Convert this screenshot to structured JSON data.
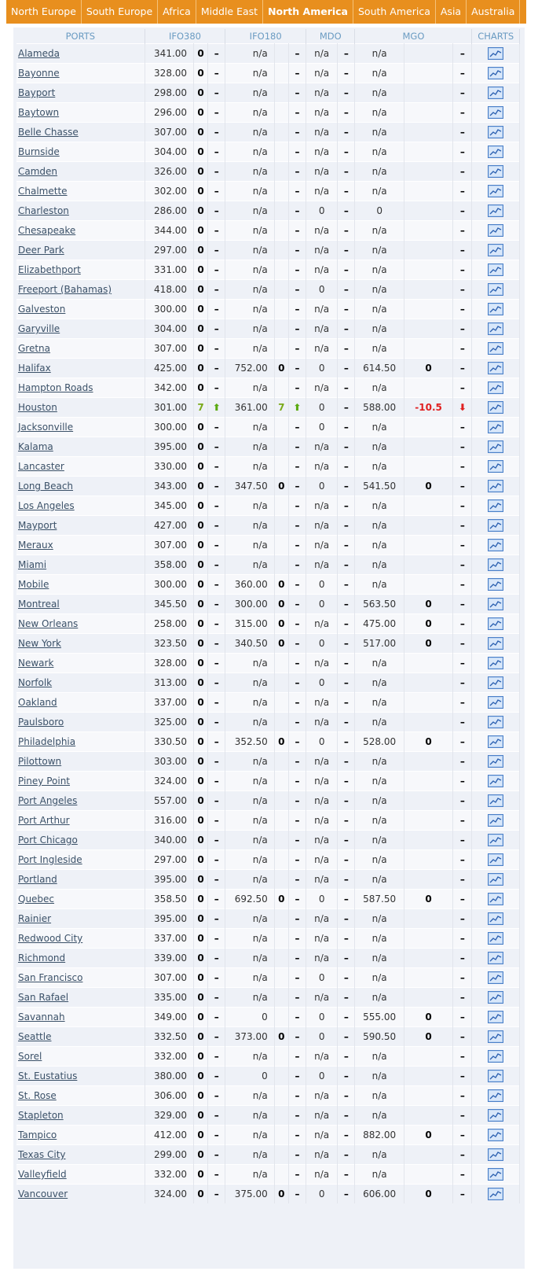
{
  "tabs": [
    {
      "label": "North Europe",
      "active": false
    },
    {
      "label": "South Europe",
      "active": false
    },
    {
      "label": "Africa",
      "active": false
    },
    {
      "label": "Middle East",
      "active": false
    },
    {
      "label": "North America",
      "active": true
    },
    {
      "label": "South America",
      "active": false
    },
    {
      "label": "Asia",
      "active": false
    },
    {
      "label": "Australia",
      "active": false
    }
  ],
  "headers": {
    "ports": "PORTS",
    "ifo380": "IFO380",
    "ifo180": "IFO180",
    "mdo": "MDO",
    "mgo": "MGO",
    "charts": "CHARTS"
  },
  "rows": [
    {
      "port": "Alameda",
      "ifo380": "341.00",
      "ifo380_chg": "0",
      "ifo380_dir": "",
      "ifo180": "n/a",
      "ifo180_chg": "",
      "ifo180_dir": "",
      "mdo": "n/a",
      "mgo": "n/a",
      "mgo_chg": "",
      "mgo_dir": ""
    },
    {
      "port": "Bayonne",
      "ifo380": "328.00",
      "ifo380_chg": "0",
      "ifo380_dir": "",
      "ifo180": "n/a",
      "ifo180_chg": "",
      "ifo180_dir": "",
      "mdo": "n/a",
      "mgo": "n/a",
      "mgo_chg": "",
      "mgo_dir": ""
    },
    {
      "port": "Bayport",
      "ifo380": "298.00",
      "ifo380_chg": "0",
      "ifo380_dir": "",
      "ifo180": "n/a",
      "ifo180_chg": "",
      "ifo180_dir": "",
      "mdo": "n/a",
      "mgo": "n/a",
      "mgo_chg": "",
      "mgo_dir": ""
    },
    {
      "port": "Baytown",
      "ifo380": "296.00",
      "ifo380_chg": "0",
      "ifo380_dir": "",
      "ifo180": "n/a",
      "ifo180_chg": "",
      "ifo180_dir": "",
      "mdo": "n/a",
      "mgo": "n/a",
      "mgo_chg": "",
      "mgo_dir": ""
    },
    {
      "port": "Belle Chasse",
      "ifo380": "307.00",
      "ifo380_chg": "0",
      "ifo380_dir": "",
      "ifo180": "n/a",
      "ifo180_chg": "",
      "ifo180_dir": "",
      "mdo": "n/a",
      "mgo": "n/a",
      "mgo_chg": "",
      "mgo_dir": ""
    },
    {
      "port": "Burnside",
      "ifo380": "304.00",
      "ifo380_chg": "0",
      "ifo380_dir": "",
      "ifo180": "n/a",
      "ifo180_chg": "",
      "ifo180_dir": "",
      "mdo": "n/a",
      "mgo": "n/a",
      "mgo_chg": "",
      "mgo_dir": ""
    },
    {
      "port": "Camden",
      "ifo380": "326.00",
      "ifo380_chg": "0",
      "ifo380_dir": "",
      "ifo180": "n/a",
      "ifo180_chg": "",
      "ifo180_dir": "",
      "mdo": "n/a",
      "mgo": "n/a",
      "mgo_chg": "",
      "mgo_dir": ""
    },
    {
      "port": "Chalmette",
      "ifo380": "302.00",
      "ifo380_chg": "0",
      "ifo380_dir": "",
      "ifo180": "n/a",
      "ifo180_chg": "",
      "ifo180_dir": "",
      "mdo": "n/a",
      "mgo": "n/a",
      "mgo_chg": "",
      "mgo_dir": ""
    },
    {
      "port": "Charleston",
      "ifo380": "286.00",
      "ifo380_chg": "0",
      "ifo380_dir": "",
      "ifo180": "n/a",
      "ifo180_chg": "",
      "ifo180_dir": "",
      "mdo": "0",
      "mgo": "0",
      "mgo_chg": "",
      "mgo_dir": ""
    },
    {
      "port": "Chesapeake",
      "ifo380": "344.00",
      "ifo380_chg": "0",
      "ifo380_dir": "",
      "ifo180": "n/a",
      "ifo180_chg": "",
      "ifo180_dir": "",
      "mdo": "n/a",
      "mgo": "n/a",
      "mgo_chg": "",
      "mgo_dir": ""
    },
    {
      "port": "Deer Park",
      "ifo380": "297.00",
      "ifo380_chg": "0",
      "ifo380_dir": "",
      "ifo180": "n/a",
      "ifo180_chg": "",
      "ifo180_dir": "",
      "mdo": "n/a",
      "mgo": "n/a",
      "mgo_chg": "",
      "mgo_dir": ""
    },
    {
      "port": "Elizabethport",
      "ifo380": "331.00",
      "ifo380_chg": "0",
      "ifo380_dir": "",
      "ifo180": "n/a",
      "ifo180_chg": "",
      "ifo180_dir": "",
      "mdo": "n/a",
      "mgo": "n/a",
      "mgo_chg": "",
      "mgo_dir": ""
    },
    {
      "port": "Freeport (Bahamas)",
      "ifo380": "418.00",
      "ifo380_chg": "0",
      "ifo380_dir": "",
      "ifo180": "n/a",
      "ifo180_chg": "",
      "ifo180_dir": "",
      "mdo": "0",
      "mgo": "n/a",
      "mgo_chg": "",
      "mgo_dir": ""
    },
    {
      "port": "Galveston",
      "ifo380": "300.00",
      "ifo380_chg": "0",
      "ifo380_dir": "",
      "ifo180": "n/a",
      "ifo180_chg": "",
      "ifo180_dir": "",
      "mdo": "n/a",
      "mgo": "n/a",
      "mgo_chg": "",
      "mgo_dir": ""
    },
    {
      "port": "Garyville",
      "ifo380": "304.00",
      "ifo380_chg": "0",
      "ifo380_dir": "",
      "ifo180": "n/a",
      "ifo180_chg": "",
      "ifo180_dir": "",
      "mdo": "n/a",
      "mgo": "n/a",
      "mgo_chg": "",
      "mgo_dir": ""
    },
    {
      "port": "Gretna",
      "ifo380": "307.00",
      "ifo380_chg": "0",
      "ifo380_dir": "",
      "ifo180": "n/a",
      "ifo180_chg": "",
      "ifo180_dir": "",
      "mdo": "n/a",
      "mgo": "n/a",
      "mgo_chg": "",
      "mgo_dir": ""
    },
    {
      "port": "Halifax",
      "ifo380": "425.00",
      "ifo380_chg": "0",
      "ifo380_dir": "",
      "ifo180": "752.00",
      "ifo180_chg": "0",
      "ifo180_dir": "",
      "mdo": "0",
      "mgo": "614.50",
      "mgo_chg": "0",
      "mgo_dir": ""
    },
    {
      "port": "Hampton Roads",
      "ifo380": "342.00",
      "ifo380_chg": "0",
      "ifo380_dir": "",
      "ifo180": "n/a",
      "ifo180_chg": "",
      "ifo180_dir": "",
      "mdo": "n/a",
      "mgo": "n/a",
      "mgo_chg": "",
      "mgo_dir": ""
    },
    {
      "port": "Houston",
      "ifo380": "301.00",
      "ifo380_chg": "7",
      "ifo380_dir": "up",
      "ifo180": "361.00",
      "ifo180_chg": "7",
      "ifo180_dir": "up",
      "mdo": "0",
      "mgo": "588.00",
      "mgo_chg": "-10.5",
      "mgo_dir": "down"
    },
    {
      "port": "Jacksonville",
      "ifo380": "300.00",
      "ifo380_chg": "0",
      "ifo380_dir": "",
      "ifo180": "n/a",
      "ifo180_chg": "",
      "ifo180_dir": "",
      "mdo": "0",
      "mgo": "n/a",
      "mgo_chg": "",
      "mgo_dir": ""
    },
    {
      "port": "Kalama",
      "ifo380": "395.00",
      "ifo380_chg": "0",
      "ifo380_dir": "",
      "ifo180": "n/a",
      "ifo180_chg": "",
      "ifo180_dir": "",
      "mdo": "n/a",
      "mgo": "n/a",
      "mgo_chg": "",
      "mgo_dir": ""
    },
    {
      "port": "Lancaster",
      "ifo380": "330.00",
      "ifo380_chg": "0",
      "ifo380_dir": "",
      "ifo180": "n/a",
      "ifo180_chg": "",
      "ifo180_dir": "",
      "mdo": "n/a",
      "mgo": "n/a",
      "mgo_chg": "",
      "mgo_dir": ""
    },
    {
      "port": "Long Beach",
      "ifo380": "343.00",
      "ifo380_chg": "0",
      "ifo380_dir": "",
      "ifo180": "347.50",
      "ifo180_chg": "0",
      "ifo180_dir": "",
      "mdo": "0",
      "mgo": "541.50",
      "mgo_chg": "0",
      "mgo_dir": ""
    },
    {
      "port": "Los Angeles",
      "ifo380": "345.00",
      "ifo380_chg": "0",
      "ifo380_dir": "",
      "ifo180": "n/a",
      "ifo180_chg": "",
      "ifo180_dir": "",
      "mdo": "n/a",
      "mgo": "n/a",
      "mgo_chg": "",
      "mgo_dir": ""
    },
    {
      "port": "Mayport",
      "ifo380": "427.00",
      "ifo380_chg": "0",
      "ifo380_dir": "",
      "ifo180": "n/a",
      "ifo180_chg": "",
      "ifo180_dir": "",
      "mdo": "n/a",
      "mgo": "n/a",
      "mgo_chg": "",
      "mgo_dir": ""
    },
    {
      "port": "Meraux",
      "ifo380": "307.00",
      "ifo380_chg": "0",
      "ifo380_dir": "",
      "ifo180": "n/a",
      "ifo180_chg": "",
      "ifo180_dir": "",
      "mdo": "n/a",
      "mgo": "n/a",
      "mgo_chg": "",
      "mgo_dir": ""
    },
    {
      "port": "Miami",
      "ifo380": "358.00",
      "ifo380_chg": "0",
      "ifo380_dir": "",
      "ifo180": "n/a",
      "ifo180_chg": "",
      "ifo180_dir": "",
      "mdo": "n/a",
      "mgo": "n/a",
      "mgo_chg": "",
      "mgo_dir": ""
    },
    {
      "port": "Mobile",
      "ifo380": "300.00",
      "ifo380_chg": "0",
      "ifo380_dir": "",
      "ifo180": "360.00",
      "ifo180_chg": "0",
      "ifo180_dir": "",
      "mdo": "0",
      "mgo": "n/a",
      "mgo_chg": "",
      "mgo_dir": ""
    },
    {
      "port": "Montreal",
      "ifo380": "345.50",
      "ifo380_chg": "0",
      "ifo380_dir": "",
      "ifo180": "300.00",
      "ifo180_chg": "0",
      "ifo180_dir": "",
      "mdo": "0",
      "mgo": "563.50",
      "mgo_chg": "0",
      "mgo_dir": ""
    },
    {
      "port": "New Orleans",
      "ifo380": "258.00",
      "ifo380_chg": "0",
      "ifo380_dir": "",
      "ifo180": "315.00",
      "ifo180_chg": "0",
      "ifo180_dir": "",
      "mdo": "n/a",
      "mgo": "475.00",
      "mgo_chg": "0",
      "mgo_dir": ""
    },
    {
      "port": "New York",
      "ifo380": "323.50",
      "ifo380_chg": "0",
      "ifo380_dir": "",
      "ifo180": "340.50",
      "ifo180_chg": "0",
      "ifo180_dir": "",
      "mdo": "0",
      "mgo": "517.00",
      "mgo_chg": "0",
      "mgo_dir": ""
    },
    {
      "port": "Newark",
      "ifo380": "328.00",
      "ifo380_chg": "0",
      "ifo380_dir": "",
      "ifo180": "n/a",
      "ifo180_chg": "",
      "ifo180_dir": "",
      "mdo": "n/a",
      "mgo": "n/a",
      "mgo_chg": "",
      "mgo_dir": ""
    },
    {
      "port": "Norfolk",
      "ifo380": "313.00",
      "ifo380_chg": "0",
      "ifo380_dir": "",
      "ifo180": "n/a",
      "ifo180_chg": "",
      "ifo180_dir": "",
      "mdo": "0",
      "mgo": "n/a",
      "mgo_chg": "",
      "mgo_dir": ""
    },
    {
      "port": "Oakland",
      "ifo380": "337.00",
      "ifo380_chg": "0",
      "ifo380_dir": "",
      "ifo180": "n/a",
      "ifo180_chg": "",
      "ifo180_dir": "",
      "mdo": "n/a",
      "mgo": "n/a",
      "mgo_chg": "",
      "mgo_dir": ""
    },
    {
      "port": "Paulsboro",
      "ifo380": "325.00",
      "ifo380_chg": "0",
      "ifo380_dir": "",
      "ifo180": "n/a",
      "ifo180_chg": "",
      "ifo180_dir": "",
      "mdo": "n/a",
      "mgo": "n/a",
      "mgo_chg": "",
      "mgo_dir": ""
    },
    {
      "port": "Philadelphia",
      "ifo380": "330.50",
      "ifo380_chg": "0",
      "ifo380_dir": "",
      "ifo180": "352.50",
      "ifo180_chg": "0",
      "ifo180_dir": "",
      "mdo": "0",
      "mgo": "528.00",
      "mgo_chg": "0",
      "mgo_dir": ""
    },
    {
      "port": "Pilottown",
      "ifo380": "303.00",
      "ifo380_chg": "0",
      "ifo380_dir": "",
      "ifo180": "n/a",
      "ifo180_chg": "",
      "ifo180_dir": "",
      "mdo": "n/a",
      "mgo": "n/a",
      "mgo_chg": "",
      "mgo_dir": ""
    },
    {
      "port": "Piney Point",
      "ifo380": "324.00",
      "ifo380_chg": "0",
      "ifo380_dir": "",
      "ifo180": "n/a",
      "ifo180_chg": "",
      "ifo180_dir": "",
      "mdo": "n/a",
      "mgo": "n/a",
      "mgo_chg": "",
      "mgo_dir": ""
    },
    {
      "port": "Port Angeles",
      "ifo380": "557.00",
      "ifo380_chg": "0",
      "ifo380_dir": "",
      "ifo180": "n/a",
      "ifo180_chg": "",
      "ifo180_dir": "",
      "mdo": "n/a",
      "mgo": "n/a",
      "mgo_chg": "",
      "mgo_dir": ""
    },
    {
      "port": "Port Arthur",
      "ifo380": "316.00",
      "ifo380_chg": "0",
      "ifo380_dir": "",
      "ifo180": "n/a",
      "ifo180_chg": "",
      "ifo180_dir": "",
      "mdo": "n/a",
      "mgo": "n/a",
      "mgo_chg": "",
      "mgo_dir": ""
    },
    {
      "port": "Port Chicago",
      "ifo380": "340.00",
      "ifo380_chg": "0",
      "ifo380_dir": "",
      "ifo180": "n/a",
      "ifo180_chg": "",
      "ifo180_dir": "",
      "mdo": "n/a",
      "mgo": "n/a",
      "mgo_chg": "",
      "mgo_dir": ""
    },
    {
      "port": "Port Ingleside",
      "ifo380": "297.00",
      "ifo380_chg": "0",
      "ifo380_dir": "",
      "ifo180": "n/a",
      "ifo180_chg": "",
      "ifo180_dir": "",
      "mdo": "n/a",
      "mgo": "n/a",
      "mgo_chg": "",
      "mgo_dir": ""
    },
    {
      "port": "Portland",
      "ifo380": "395.00",
      "ifo380_chg": "0",
      "ifo380_dir": "",
      "ifo180": "n/a",
      "ifo180_chg": "",
      "ifo180_dir": "",
      "mdo": "n/a",
      "mgo": "n/a",
      "mgo_chg": "",
      "mgo_dir": ""
    },
    {
      "port": "Quebec",
      "ifo380": "358.50",
      "ifo380_chg": "0",
      "ifo380_dir": "",
      "ifo180": "692.50",
      "ifo180_chg": "0",
      "ifo180_dir": "",
      "mdo": "0",
      "mgo": "587.50",
      "mgo_chg": "0",
      "mgo_dir": ""
    },
    {
      "port": "Rainier",
      "ifo380": "395.00",
      "ifo380_chg": "0",
      "ifo380_dir": "",
      "ifo180": "n/a",
      "ifo180_chg": "",
      "ifo180_dir": "",
      "mdo": "n/a",
      "mgo": "n/a",
      "mgo_chg": "",
      "mgo_dir": ""
    },
    {
      "port": "Redwood City",
      "ifo380": "337.00",
      "ifo380_chg": "0",
      "ifo380_dir": "",
      "ifo180": "n/a",
      "ifo180_chg": "",
      "ifo180_dir": "",
      "mdo": "n/a",
      "mgo": "n/a",
      "mgo_chg": "",
      "mgo_dir": ""
    },
    {
      "port": "Richmond",
      "ifo380": "339.00",
      "ifo380_chg": "0",
      "ifo380_dir": "",
      "ifo180": "n/a",
      "ifo180_chg": "",
      "ifo180_dir": "",
      "mdo": "n/a",
      "mgo": "n/a",
      "mgo_chg": "",
      "mgo_dir": ""
    },
    {
      "port": "San Francisco",
      "ifo380": "307.00",
      "ifo380_chg": "0",
      "ifo380_dir": "",
      "ifo180": "n/a",
      "ifo180_chg": "",
      "ifo180_dir": "",
      "mdo": "0",
      "mgo": "n/a",
      "mgo_chg": "",
      "mgo_dir": ""
    },
    {
      "port": "San Rafael",
      "ifo380": "335.00",
      "ifo380_chg": "0",
      "ifo380_dir": "",
      "ifo180": "n/a",
      "ifo180_chg": "",
      "ifo180_dir": "",
      "mdo": "n/a",
      "mgo": "n/a",
      "mgo_chg": "",
      "mgo_dir": ""
    },
    {
      "port": "Savannah",
      "ifo380": "349.00",
      "ifo380_chg": "0",
      "ifo380_dir": "",
      "ifo180": "0",
      "ifo180_chg": "",
      "ifo180_dir": "",
      "mdo": "0",
      "mgo": "555.00",
      "mgo_chg": "0",
      "mgo_dir": ""
    },
    {
      "port": "Seattle",
      "ifo380": "332.50",
      "ifo380_chg": "0",
      "ifo380_dir": "",
      "ifo180": "373.00",
      "ifo180_chg": "0",
      "ifo180_dir": "",
      "mdo": "0",
      "mgo": "590.50",
      "mgo_chg": "0",
      "mgo_dir": ""
    },
    {
      "port": "Sorel",
      "ifo380": "332.00",
      "ifo380_chg": "0",
      "ifo380_dir": "",
      "ifo180": "n/a",
      "ifo180_chg": "",
      "ifo180_dir": "",
      "mdo": "n/a",
      "mgo": "n/a",
      "mgo_chg": "",
      "mgo_dir": ""
    },
    {
      "port": "St. Eustatius",
      "ifo380": "380.00",
      "ifo380_chg": "0",
      "ifo380_dir": "",
      "ifo180": "0",
      "ifo180_chg": "",
      "ifo180_dir": "",
      "mdo": "0",
      "mgo": "n/a",
      "mgo_chg": "",
      "mgo_dir": ""
    },
    {
      "port": "St. Rose",
      "ifo380": "306.00",
      "ifo380_chg": "0",
      "ifo380_dir": "",
      "ifo180": "n/a",
      "ifo180_chg": "",
      "ifo180_dir": "",
      "mdo": "n/a",
      "mgo": "n/a",
      "mgo_chg": "",
      "mgo_dir": ""
    },
    {
      "port": "Stapleton",
      "ifo380": "329.00",
      "ifo380_chg": "0",
      "ifo380_dir": "",
      "ifo180": "n/a",
      "ifo180_chg": "",
      "ifo180_dir": "",
      "mdo": "n/a",
      "mgo": "n/a",
      "mgo_chg": "",
      "mgo_dir": ""
    },
    {
      "port": "Tampico",
      "ifo380": "412.00",
      "ifo380_chg": "0",
      "ifo380_dir": "",
      "ifo180": "n/a",
      "ifo180_chg": "",
      "ifo180_dir": "",
      "mdo": "n/a",
      "mgo": "882.00",
      "mgo_chg": "0",
      "mgo_dir": ""
    },
    {
      "port": "Texas City",
      "ifo380": "299.00",
      "ifo380_chg": "0",
      "ifo380_dir": "",
      "ifo180": "n/a",
      "ifo180_chg": "",
      "ifo180_dir": "",
      "mdo": "n/a",
      "mgo": "n/a",
      "mgo_chg": "",
      "mgo_dir": ""
    },
    {
      "port": "Valleyfield",
      "ifo380": "332.00",
      "ifo380_chg": "0",
      "ifo380_dir": "",
      "ifo180": "n/a",
      "ifo180_chg": "",
      "ifo180_dir": "",
      "mdo": "n/a",
      "mgo": "n/a",
      "mgo_chg": "",
      "mgo_dir": ""
    },
    {
      "port": "Vancouver",
      "ifo380": "324.00",
      "ifo380_chg": "0",
      "ifo380_dir": "",
      "ifo180": "375.00",
      "ifo180_chg": "0",
      "ifo180_dir": "",
      "mdo": "0",
      "mgo": "606.00",
      "mgo_chg": "0",
      "mgo_dir": ""
    }
  ],
  "icons": {
    "chart": "line-chart-icon",
    "up": "arrow-up-icon",
    "down": "arrow-down-icon"
  },
  "colors": {
    "tab_bar": "#e88f1e",
    "header_text": "#6a9bc2",
    "up": "#7aaa1a",
    "down": "#e02020"
  }
}
